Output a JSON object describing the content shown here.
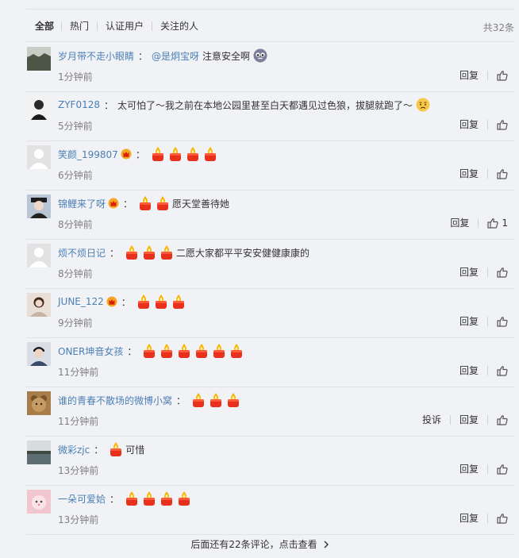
{
  "filter": {
    "tabs": [
      "全部",
      "热门",
      "认证用户",
      "关注的人"
    ],
    "active": 0,
    "total": "共32条"
  },
  "actions": {
    "reply": "回复",
    "report": "投诉"
  },
  "comments": [
    {
      "user": "岁月带不走小眼睛",
      "vip": false,
      "mention": "@是炯宝呀",
      "text": "注意安全啊",
      "emoji": "cry-face",
      "candles": 0,
      "time": "1分钟前",
      "report": false,
      "likes": "",
      "avatar": "landscape-dark"
    },
    {
      "user": "ZYF0128",
      "vip": false,
      "mention": "",
      "text": "太可怕了～我之前在本地公园里甚至白天都遇见过色狼，拔腿就跑了～",
      "emoji": "sad-face",
      "candles": 0,
      "time": "5分钟前",
      "report": false,
      "likes": "",
      "avatar": "portrait-dark"
    },
    {
      "user": "笑颜_199807",
      "vip": true,
      "mention": "",
      "text": "",
      "emoji": "",
      "candles": 4,
      "time": "6分钟前",
      "report": false,
      "likes": "",
      "avatar": "default"
    },
    {
      "user": "锦鲤来了呀",
      "vip": true,
      "mention": "",
      "text": "愿天堂善待她",
      "emoji": "",
      "candles": 2,
      "time": "8分钟前",
      "report": false,
      "likes": "1",
      "avatar": "portrait-hat"
    },
    {
      "user": "烦不烦日记",
      "vip": false,
      "mention": "",
      "text": "二愿大家都平平安安健健康康的",
      "emoji": "",
      "candles": 3,
      "time": "8分钟前",
      "report": false,
      "likes": "",
      "avatar": "default"
    },
    {
      "user": "JUNE_122",
      "vip": true,
      "mention": "",
      "text": "",
      "emoji": "",
      "candles": 3,
      "time": "9分钟前",
      "report": false,
      "likes": "",
      "avatar": "portrait-light"
    },
    {
      "user": "ONER坤音女孩",
      "vip": false,
      "mention": "",
      "text": "",
      "emoji": "",
      "candles": 6,
      "time": "11分钟前",
      "report": false,
      "likes": "",
      "avatar": "portrait-boy"
    },
    {
      "user": "谁的青春不散场的微博小窝",
      "vip": false,
      "mention": "",
      "text": "",
      "emoji": "",
      "candles": 3,
      "time": "11分钟前",
      "report": true,
      "likes": "",
      "avatar": "bear"
    },
    {
      "user": "微彩zjc",
      "vip": false,
      "mention": "",
      "text": "可惜",
      "emoji": "",
      "candles": 1,
      "time": "13分钟前",
      "report": false,
      "likes": "",
      "avatar": "lake"
    },
    {
      "user": "一朵可爱姶",
      "vip": false,
      "mention": "",
      "text": "",
      "emoji": "",
      "candles": 4,
      "time": "13分钟前",
      "report": false,
      "likes": "",
      "avatar": "pink"
    }
  ],
  "more": "后面还有22条评论，点击查看"
}
